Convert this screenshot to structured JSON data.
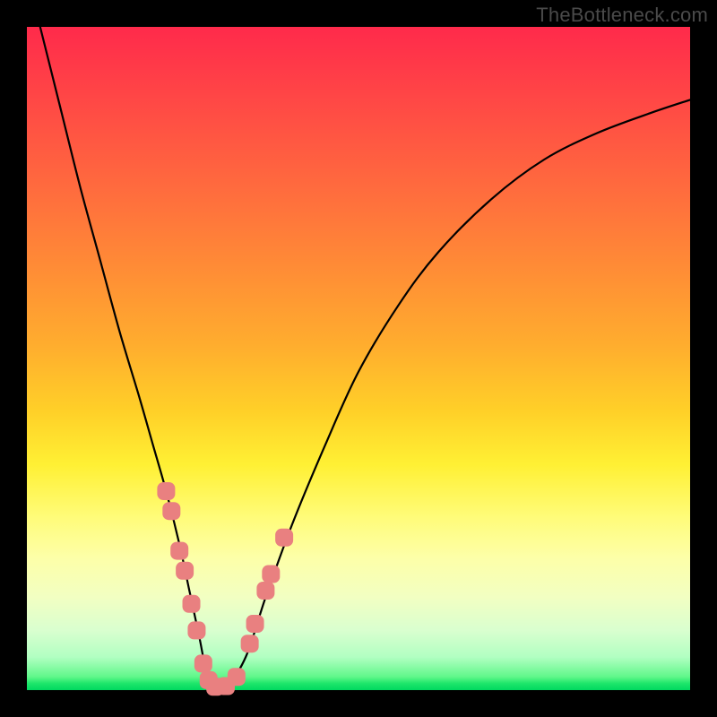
{
  "watermark": "TheBottleneck.com",
  "chart_data": {
    "type": "line",
    "title": "",
    "xlabel": "",
    "ylabel": "",
    "xlim": [
      0,
      100
    ],
    "ylim": [
      0,
      100
    ],
    "grid": false,
    "legend": false,
    "series": [
      {
        "name": "bottleneck-curve",
        "color": "#000000",
        "x": [
          2,
          5,
          8,
          11,
          14,
          17,
          19,
          21,
          23,
          24.5,
          26,
          27,
          28,
          30,
          33,
          36,
          40,
          45,
          50,
          56,
          62,
          70,
          78,
          86,
          94,
          100
        ],
        "y": [
          100,
          88,
          76,
          65,
          54,
          44,
          37,
          30,
          22,
          15,
          8,
          3,
          0.5,
          0.5,
          5,
          14,
          25,
          37,
          48,
          58,
          66,
          74,
          80,
          84,
          87,
          89
        ]
      }
    ],
    "markers": [
      {
        "name": "highlight-dots",
        "shape": "rounded-square",
        "color": "#e98080",
        "size": 20,
        "points": [
          {
            "x": 21.0,
            "y": 30
          },
          {
            "x": 21.8,
            "y": 27
          },
          {
            "x": 23.0,
            "y": 21
          },
          {
            "x": 23.8,
            "y": 18
          },
          {
            "x": 24.8,
            "y": 13
          },
          {
            "x": 25.6,
            "y": 9
          },
          {
            "x": 26.6,
            "y": 4
          },
          {
            "x": 27.4,
            "y": 1.5
          },
          {
            "x": 28.4,
            "y": 0.5
          },
          {
            "x": 30.0,
            "y": 0.6
          },
          {
            "x": 31.6,
            "y": 2
          },
          {
            "x": 33.6,
            "y": 7
          },
          {
            "x": 34.4,
            "y": 10
          },
          {
            "x": 36.0,
            "y": 15
          },
          {
            "x": 36.8,
            "y": 17.5
          },
          {
            "x": 38.8,
            "y": 23
          }
        ]
      }
    ]
  }
}
